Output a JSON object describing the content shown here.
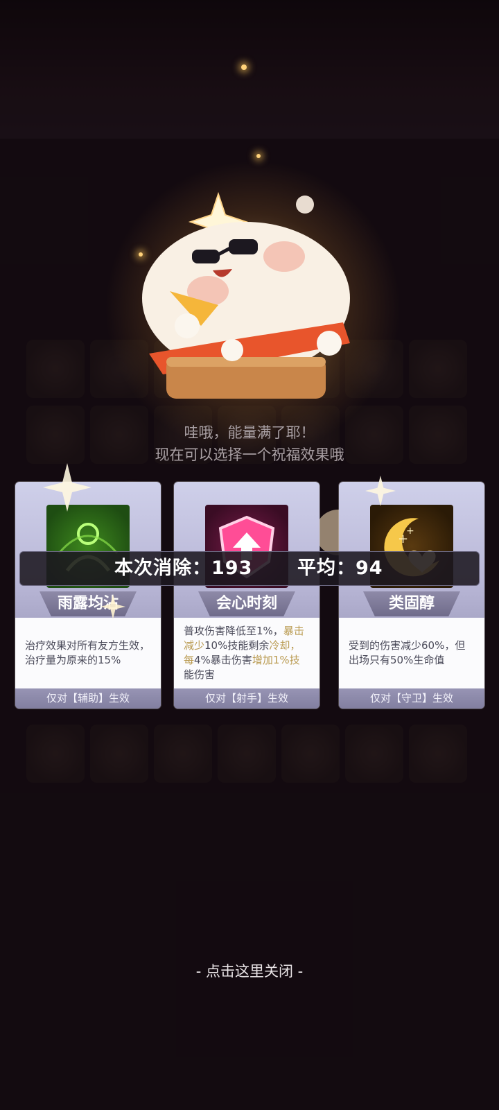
{
  "message": {
    "line1": "哇哦，能量满了耶！",
    "line2": "现在可以选择一个祝福效果哦"
  },
  "score_bar": {
    "clear_label": "本次消除：",
    "clear_value": "193",
    "avg_label": "平均：",
    "avg_value": "94"
  },
  "cards": [
    {
      "name": "雨露均沾",
      "icon": "healing-aura-icon",
      "desc_parts": [
        {
          "text": "治疗效果对所有友方生效，治疗量为原来的15%",
          "highlight": false
        }
      ],
      "scope": "仅对【辅助】生效",
      "accent": "#7be04a"
    },
    {
      "name": "会心时刻",
      "icon": "crit-shield-icon",
      "desc_parts": [
        {
          "text": "普攻伤害降低至1%，",
          "highlight": false
        },
        {
          "text": "暴击减少",
          "highlight": true
        },
        {
          "text": "10%技能剩余",
          "highlight": false
        },
        {
          "text": "冷却，每",
          "highlight": true
        },
        {
          "text": "4%暴击伤害",
          "highlight": false
        },
        {
          "text": "增加1%技",
          "highlight": true
        },
        {
          "text": "能伤害",
          "highlight": false
        }
      ],
      "scope": "仅对【射手】生效",
      "accent": "#ff3f8a"
    },
    {
      "name": "类固醇",
      "icon": "heart-moon-icon",
      "desc_parts": [
        {
          "text": "受到的伤害减少60%，但出场只有50%生命值",
          "highlight": false
        }
      ],
      "scope": "仅对【守卫】生效",
      "accent": "#f1c24a"
    }
  ],
  "close_hint": "- 点击这里关闭 -"
}
